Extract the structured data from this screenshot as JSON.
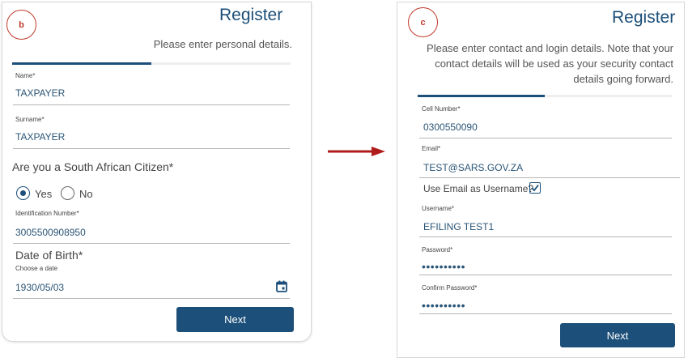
{
  "panel_b": {
    "badge": "b",
    "title": "Register",
    "subtitle": "Please enter personal details.",
    "progress": 0.5,
    "name": {
      "label": "Name*",
      "value": "TAXPAYER"
    },
    "surname": {
      "label": "Surname*",
      "value": "TAXPAYER"
    },
    "citizen_question": "Are you a South African Citizen*",
    "yes_label": "Yes",
    "no_label": "No",
    "id_number": {
      "label": "Identification Number*",
      "value": "3005500908950"
    },
    "dob": {
      "heading": "Date of Birth*",
      "label": "Choose a date",
      "value": "1930/05/03"
    },
    "next_label": "Next"
  },
  "panel_c": {
    "badge": "c",
    "title": "Register",
    "subtitle_lines": [
      "Please enter contact and login details. Note that your",
      "contact details will be used as your security contact",
      "details going forward."
    ],
    "progress": 0.5,
    "cell": {
      "label": "Cell Number*",
      "value": "0300550090"
    },
    "email": {
      "label": "Email*",
      "value": "TEST@SARS.GOV.ZA"
    },
    "use_email_label": "Use Email as Username?",
    "use_email_checked": true,
    "username": {
      "label": "Username*",
      "value": "EFILING TEST1"
    },
    "password": {
      "label": "Password*",
      "value": "••••••••••"
    },
    "confirm_password": {
      "label": "Confirm Password*",
      "value": "••••••••••"
    },
    "next_label": "Next"
  },
  "colors": {
    "accent": "#1c4f79",
    "badge": "#c0392b",
    "arrow": "#b01c1c"
  }
}
